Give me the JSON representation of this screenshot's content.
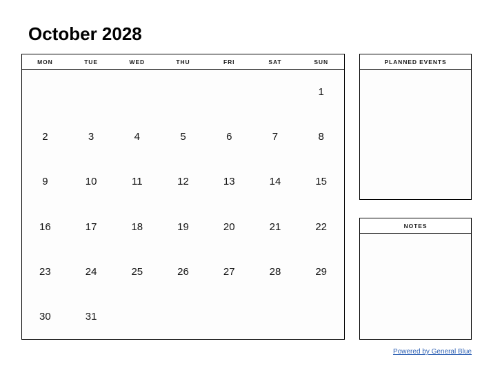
{
  "header": {
    "title": "October 2028"
  },
  "calendar": {
    "weekdays": [
      "MON",
      "TUE",
      "WED",
      "THU",
      "FRI",
      "SAT",
      "SUN"
    ],
    "weeks": [
      [
        "",
        "",
        "",
        "",
        "",
        "",
        "1"
      ],
      [
        "2",
        "3",
        "4",
        "5",
        "6",
        "7",
        "8"
      ],
      [
        "9",
        "10",
        "11",
        "12",
        "13",
        "14",
        "15"
      ],
      [
        "16",
        "17",
        "18",
        "19",
        "20",
        "21",
        "22"
      ],
      [
        "23",
        "24",
        "25",
        "26",
        "27",
        "28",
        "29"
      ],
      [
        "30",
        "31",
        "",
        "",
        "",
        "",
        ""
      ]
    ]
  },
  "panels": {
    "planned_events": {
      "title": "PLANNED EVENTS",
      "content": ""
    },
    "notes": {
      "title": "NOTES",
      "content": ""
    }
  },
  "footer": {
    "link_label": "Powered by General Blue"
  },
  "colors": {
    "text": "#000000",
    "border": "#000000",
    "cell_background": "#fdfdfd",
    "link": "#2c5fb3"
  }
}
